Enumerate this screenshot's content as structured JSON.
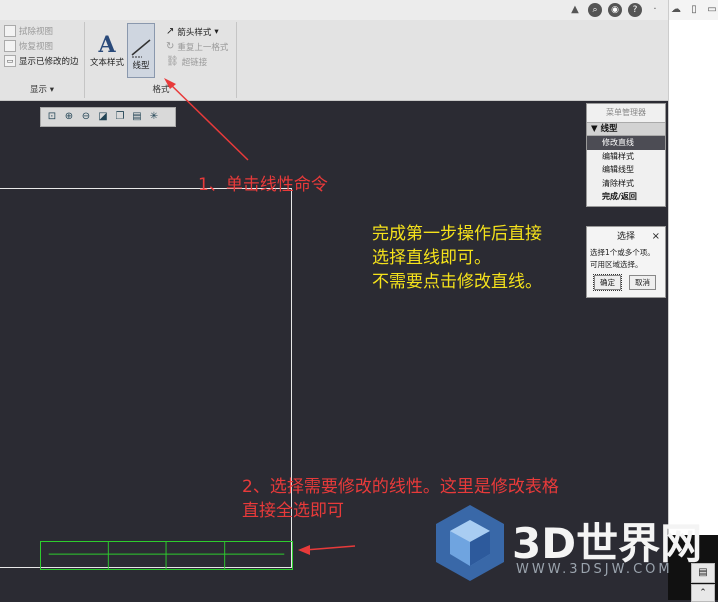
{
  "ribbon": {
    "display_group": {
      "items": [
        "拭除视图",
        "恢复视图",
        "显示已修改的边"
      ],
      "label": "显示"
    },
    "format_group": {
      "text_style_label": "文本样式",
      "line_style_label": "线型",
      "arrow_style_label": "箭头样式",
      "repeat_format_label": "重复上一格式",
      "hyperlink_label": "超链接",
      "label": "格式"
    }
  },
  "menu_manager": {
    "title": "菜单管理器",
    "category": "线型",
    "items": [
      "修改直线",
      "编辑样式",
      "编辑线型",
      "清除样式",
      "完成/返回"
    ]
  },
  "select_dialog": {
    "title": "选择",
    "close": "×",
    "line1": "选择1个或多个项。",
    "line2": "可用区域选择。",
    "ok": "确定",
    "cancel": "取消"
  },
  "annotations": {
    "step1": "1、单击线性命令",
    "note_line1": "完成第一步操作后直接",
    "note_line2": "选择直线即可。",
    "note_line3": "不需要点击修改直线。",
    "step2_line1": "2、选择需要修改的线性。这里是修改表格",
    "step2_line2": "直接全选即可"
  },
  "watermark": {
    "name": "3D世界网",
    "url": "WWW.3DSJW.COM"
  },
  "colors": {
    "canvas": "#2b2b33",
    "annotation_red": "#e83a3a",
    "annotation_yellow": "#f5e21b",
    "table_green": "#2ecc2e"
  }
}
